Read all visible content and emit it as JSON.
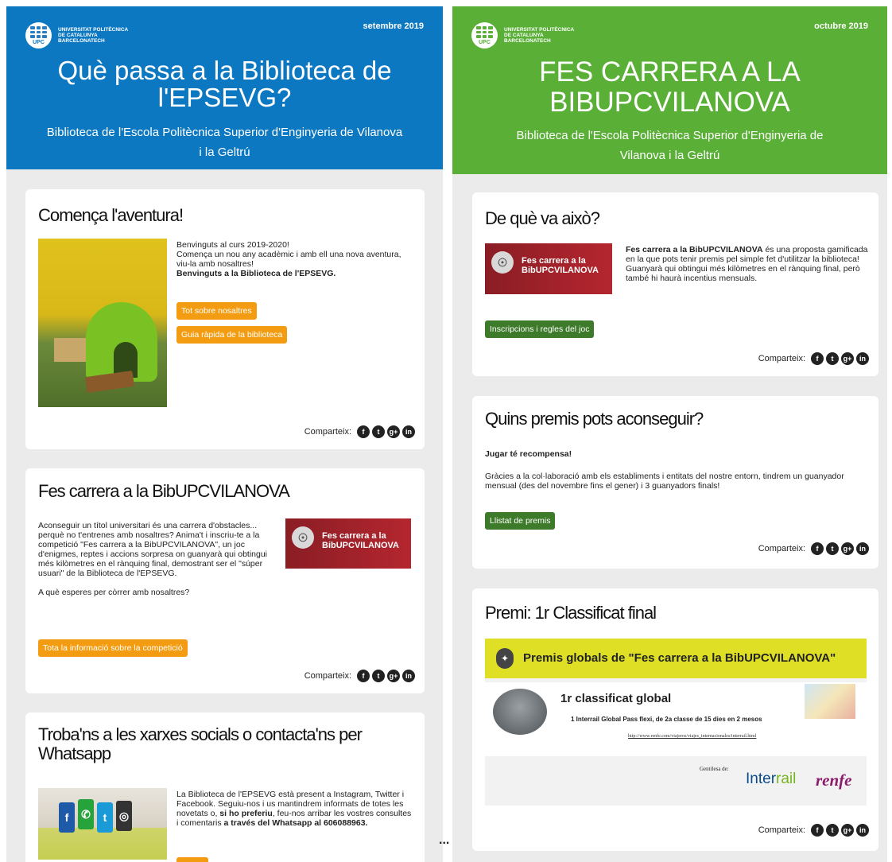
{
  "university": {
    "name_lines": [
      "UNIVERSITAT POLITÈCNICA",
      "DE CATALUNYA",
      "BARCELONATECH"
    ],
    "abbr": "UPC"
  },
  "colors": {
    "left_header": "#0d78c2",
    "right_header": "#5aaf37",
    "orange_button": "#f39c12",
    "green_button": "#3d7a2a"
  },
  "left": {
    "date": "setembre 2019",
    "title": "Què passa a la Biblioteca de l'EPSEVG?",
    "subtitle": "Biblioteca de l'Escola Politècnica Superior d'Enginyeria de Vilanova i la Geltrú",
    "card1": {
      "heading": "Comença l'aventura!",
      "p1": "Benvinguts al curs 2019-2020!",
      "p2": "Comença un nou any acadèmic i amb ell una nova aventura, viu-la amb nosaltres!",
      "p3": "Benvinguts a la Biblioteca de l'EPSEVG.",
      "button1": "Tot sobre nosaltres",
      "button2": "Guia ràpida de la biblioteca"
    },
    "card2": {
      "heading": "Fes carrera a la BibUPCVILANOVA",
      "body": "Aconseguir un títol universitari és una carrera d'obstacles... perquè no t'entrenes amb nosaltres? Anima't i inscriu-te a la competició \"Fes carrera a la BibUPCVILANOVA\", un joc d'enigmes, reptes i accions sorpresa on guanyarà qui obtingui més kilòmetres en el rànquing final, demostrant ser el \"súper usuari\" de la Biblioteca de l'EPSEVG.",
      "question": "A què esperes per còrrer amb nosaltres?",
      "banner_text": "Fes carrera a la BibUPCVILANOVA",
      "button": "Tota la informació sobre la competició"
    },
    "card3": {
      "heading": "Troba'ns a les xarxes socials o contacta'ns per Whatsapp",
      "body_start": "La Biblioteca de l'EPSEVG està present a Instagram, Twitter i Facebook. Seguiu-nos i us mantindrem informats de totes les novetats o, ",
      "body_bold1": "si ho preferiu",
      "body_mid": ", feu-nos arribar les vostres consultes i comentaris ",
      "body_bold2": "a través del Whatsapp al 606088963."
    }
  },
  "right": {
    "date": "octubre 2019",
    "title": "FES CARRERA A LA BIBUPCVILANOVA",
    "subtitle": "Biblioteca de l'Escola Politècnica Superior d'Enginyeria de Vilanova i la Geltrú",
    "card1": {
      "heading": "De què va això?",
      "bold": "Fes carrera a la BibUPCVILANOVA",
      "body": " és una proposta gamificada en la que pots tenir premis pel simple fet d'utilitzar la biblioteca!",
      "body2": "Guanyarà qui obtingui més kilòmetres en el rànquing final, però també hi haurà incentius mensuals.",
      "banner_text": "Fes carrera a la BibUPCVILANOVA",
      "button": "Inscripcions i regles del joc"
    },
    "card2": {
      "heading": "Quins premis pots aconseguir?",
      "lead": "Jugar té recompensa!",
      "body": "Gràcies a la col·laboració amb els establiments i entitats del nostre entorn, tindrem un guanyador mensual (des del novembre fins el gener) i 3 guanyadors finals!",
      "button": "Llistat de premis"
    },
    "card3": {
      "heading": "Premi: 1r Classificat final",
      "prize_header": "Premis globals de \"Fes carrera a la BibUPCVILANOVA\"",
      "prize_title": "1r classificat global",
      "prize_desc": "1 Interrail Global Pass flexi, de 2a classe de 15 dies en 2 mesos",
      "prize_url": "http://www.renfe.com/viajeros/viajes_internacionales/interrail.html",
      "gentilesa": "Gentilesa de:",
      "sponsor1": "Inter",
      "sponsor1b": "rail",
      "sponsor2": "renfe"
    }
  },
  "share": {
    "label": "Comparteix:",
    "icons": [
      "f",
      "t",
      "g+",
      "in"
    ]
  },
  "ellipsis": "..."
}
